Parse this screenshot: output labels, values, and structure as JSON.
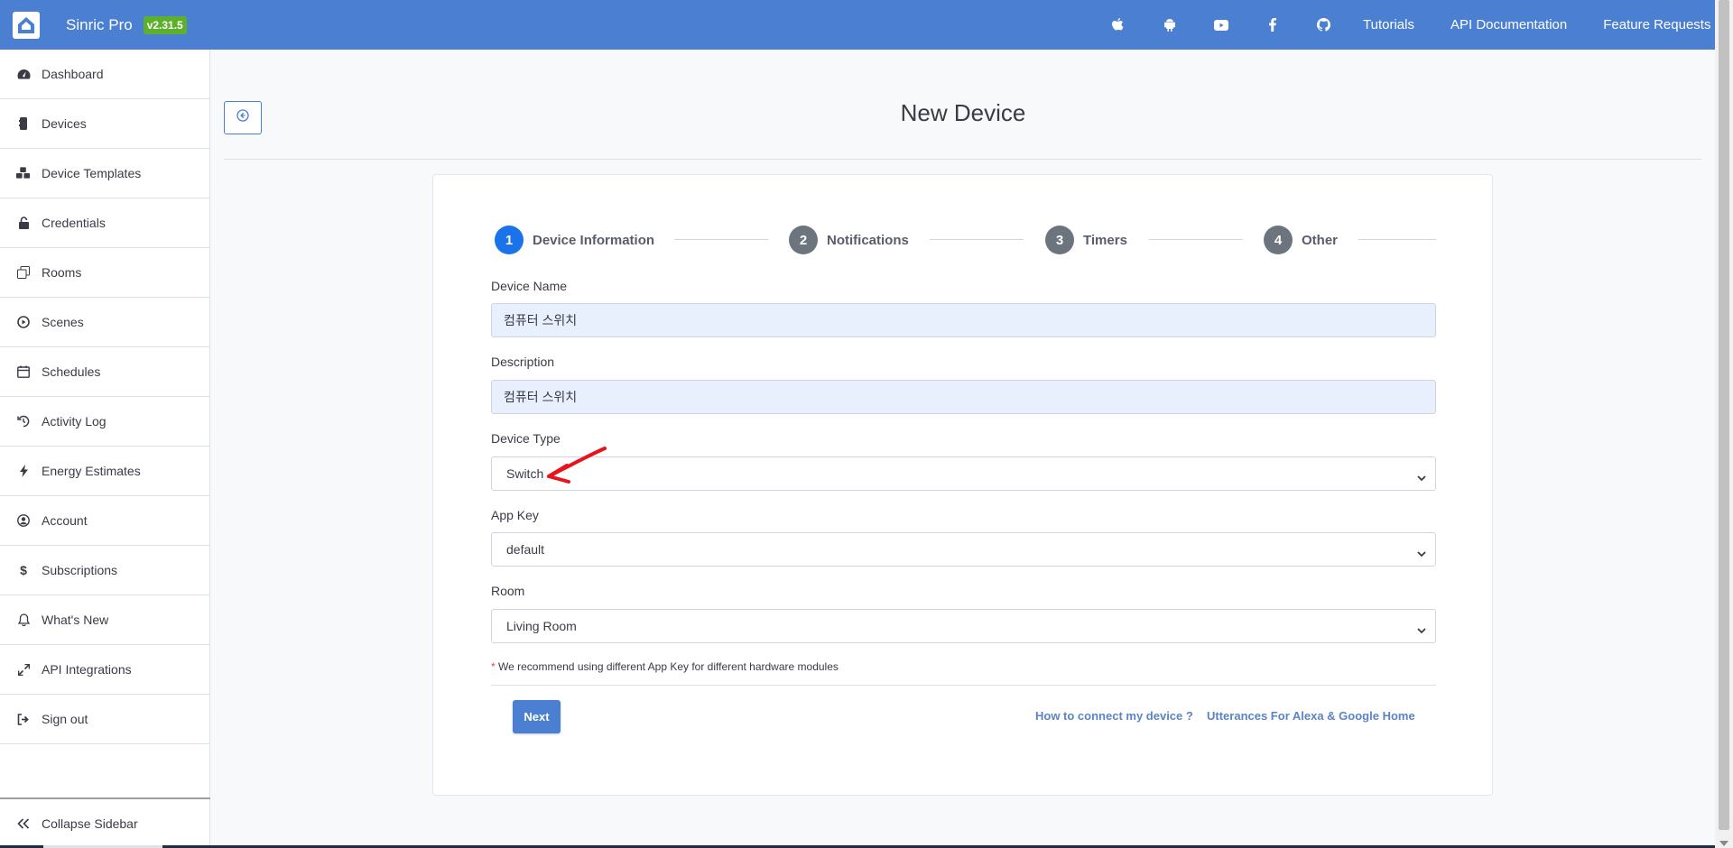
{
  "app": {
    "name": "Sinric Pro",
    "version": "v2.31.5"
  },
  "topnav": {
    "icons": [
      "apple-icon",
      "android-icon",
      "youtube-icon",
      "facebook-icon",
      "github-icon"
    ],
    "links": [
      "Tutorials",
      "API Documentation",
      "Feature Requests"
    ]
  },
  "sidebar": {
    "items": [
      {
        "label": "Dashboard",
        "icon": "tachometer-icon"
      },
      {
        "label": "Devices",
        "icon": "device-icon"
      },
      {
        "label": "Device Templates",
        "icon": "templates-icon"
      },
      {
        "label": "Credentials",
        "icon": "unlock-icon"
      },
      {
        "label": "Rooms",
        "icon": "rooms-icon"
      },
      {
        "label": "Scenes",
        "icon": "play-circle-icon"
      },
      {
        "label": "Schedules",
        "icon": "calendar-icon"
      },
      {
        "label": "Activity Log",
        "icon": "history-icon"
      },
      {
        "label": "Energy Estimates",
        "icon": "bolt-icon"
      },
      {
        "label": "Account",
        "icon": "user-circle-icon"
      },
      {
        "label": "Subscriptions",
        "icon": "dollar-icon"
      },
      {
        "label": "What's New",
        "icon": "bell-icon"
      },
      {
        "label": "API Integrations",
        "icon": "expand-arrows-icon"
      },
      {
        "label": "Sign out",
        "icon": "sign-out-icon"
      }
    ],
    "collapse_label": "Collapse Sidebar"
  },
  "page": {
    "title": "New Device"
  },
  "stepper": {
    "steps": [
      {
        "num": "1",
        "label": "Device Information",
        "active": true
      },
      {
        "num": "2",
        "label": "Notifications",
        "active": false
      },
      {
        "num": "3",
        "label": "Timers",
        "active": false
      },
      {
        "num": "4",
        "label": "Other",
        "active": false
      }
    ]
  },
  "form": {
    "device_name": {
      "label": "Device Name",
      "value": "컴퓨터 스위치"
    },
    "description": {
      "label": "Description",
      "value": "컴퓨터 스위치"
    },
    "device_type": {
      "label": "Device Type",
      "value": "Switch"
    },
    "app_key": {
      "label": "App Key",
      "value": "default"
    },
    "room": {
      "label": "Room",
      "value": "Living Room"
    },
    "note_star": "*",
    "note": " We recommend using different App Key for different hardware modules",
    "next_label": "Next",
    "help_link_1": "How to connect my device ?",
    "help_link_2": "Utterances For Alexa & Google Home"
  },
  "colors": {
    "topbar": "#4a7fd1",
    "version_badge": "#5cb02a",
    "active_step": "#1a73e8",
    "inactive_step": "#6c757d",
    "input_filled": "#e8f0fe",
    "annotation_arrow": "#e8141c"
  }
}
